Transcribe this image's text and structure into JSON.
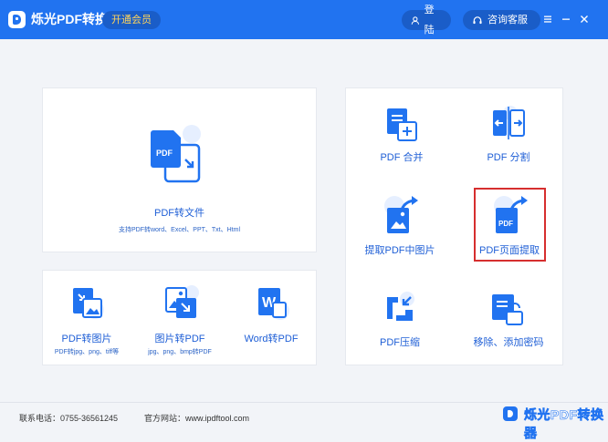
{
  "header": {
    "app_title": "烁光PDF转换器",
    "vip_label": "开通会员",
    "login_label": "登陆",
    "service_label": "咨询客服"
  },
  "main_card": {
    "title": "PDF转文件",
    "subtitle": "支持PDF转word、Excel、PPT、Txt、Html",
    "icon_badge": "PDF"
  },
  "bottom_tools": [
    {
      "label": "PDF转图片",
      "subtitle": "PDF转jpg、png、tiff等"
    },
    {
      "label": "图片转PDF",
      "subtitle": "jpg、png、bmp转PDF"
    },
    {
      "label": "Word转PDF",
      "subtitle": "",
      "icon_letter": "W"
    }
  ],
  "right_tools": [
    {
      "label": "PDF 合并"
    },
    {
      "label": "PDF 分割"
    },
    {
      "label": "提取PDF中图片"
    },
    {
      "label": "PDF页面提取",
      "icon_badge": "PDF"
    },
    {
      "label": "PDF压缩"
    },
    {
      "label": "移除、添加密码"
    }
  ],
  "footer": {
    "phone": "联系电话：0755-36561245",
    "website": "官方网站：www.ipdftool.com",
    "watermark": "烁光PDF转换器"
  },
  "colors": {
    "titlebar": "#2173f0",
    "accent": "#1f5fd6",
    "highlight": "#d62e2e"
  }
}
